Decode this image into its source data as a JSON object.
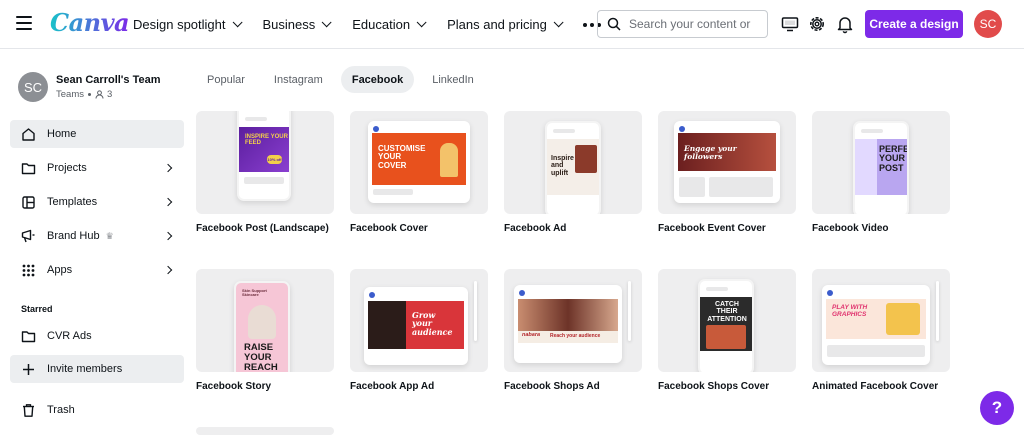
{
  "header": {
    "logo": "Canva",
    "nav": [
      {
        "label": "Design spotlight",
        "has_menu": true
      },
      {
        "label": "Business",
        "has_menu": true
      },
      {
        "label": "Education",
        "has_menu": true
      },
      {
        "label": "Plans and pricing",
        "has_menu": true
      }
    ],
    "search_placeholder": "Search your content or",
    "create_label": "Create a design",
    "avatar_initials": "SC",
    "accent_color": "#7d2ae8",
    "avatar_color": "#e14b4b"
  },
  "sidebar": {
    "team_initials": "SC",
    "team_name": "Sean Carroll's Team",
    "team_type": "Teams",
    "member_count": "3",
    "items": [
      {
        "label": "Home",
        "icon": "home-icon",
        "active": true
      },
      {
        "label": "Projects",
        "icon": "folder-icon",
        "has_submenu": true
      },
      {
        "label": "Templates",
        "icon": "templates-icon",
        "has_submenu": true
      },
      {
        "label": "Brand Hub",
        "icon": "brand-hub-icon",
        "has_submenu": true
      },
      {
        "label": "Apps",
        "icon": "apps-grid-icon",
        "has_submenu": true
      }
    ],
    "starred_label": "Starred",
    "starred": [
      {
        "label": "CVR Ads",
        "icon": "folder-icon"
      }
    ],
    "invite_label": "Invite members",
    "trash_label": "Trash"
  },
  "tabs": [
    {
      "label": "Popular",
      "active": false
    },
    {
      "label": "Instagram",
      "active": false
    },
    {
      "label": "Facebook",
      "active": true
    },
    {
      "label": "LinkedIn",
      "active": false
    }
  ],
  "designs": [
    {
      "label": "Facebook Post (Landscape)",
      "thumb_text": "INSPIRE YOUR FEED",
      "thumb_badge": "10% off"
    },
    {
      "label": "Facebook Cover",
      "thumb_text": "CUSTOMISE YOUR COVER"
    },
    {
      "label": "Facebook Ad",
      "thumb_text": "Inspire and uplift"
    },
    {
      "label": "Facebook Event Cover",
      "thumb_text": "Engage your followers"
    },
    {
      "label": "Facebook Video",
      "thumb_text": "PERFECT YOUR POST"
    },
    {
      "label": "Facebook Story",
      "thumb_text": "RAISE YOUR REACH",
      "thumb_small": "Skin Support Skincare"
    },
    {
      "label": "Facebook App Ad",
      "thumb_text": "Grow your audience"
    },
    {
      "label": "Facebook Shops Ad",
      "thumb_text": "Reach your audience",
      "thumb_brand": "nabara"
    },
    {
      "label": "Facebook Shops Cover",
      "thumb_text": "CATCH THEIR ATTENTION"
    },
    {
      "label": "Animated Facebook Cover",
      "thumb_text": "PLAY WITH GRAPHICS"
    }
  ],
  "help_label": "?"
}
